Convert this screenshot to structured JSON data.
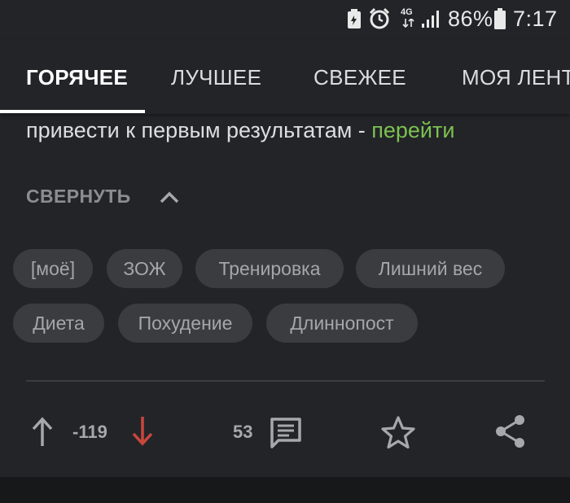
{
  "status_bar": {
    "network": "4G",
    "battery": "86%",
    "time": "7:17",
    "icons": [
      "battery-saver-icon",
      "alarm-icon",
      "network-4g-icon",
      "signal-icon",
      "battery-icon"
    ]
  },
  "tabs": [
    {
      "label": "ГОРЯЧЕЕ",
      "active": true
    },
    {
      "label": "ЛУЧШЕЕ",
      "active": false
    },
    {
      "label": "СВЕЖЕЕ",
      "active": false
    },
    {
      "label": "МОЯ ЛЕНТА",
      "active": false
    }
  ],
  "post": {
    "lead_text": "привести к первым результатам - ",
    "lead_link": "перейти",
    "collapse_label": "СВЕРНУТЬ",
    "tags": [
      "[моё]",
      "ЗОЖ",
      "Тренировка",
      "Лишний вес",
      "Диета",
      "Похудение",
      "Длиннопост"
    ],
    "rating": "-119",
    "comments": "53"
  },
  "colors": {
    "background": "#222428",
    "link": "#7cc150",
    "downvote": "#c9463d",
    "tag_bg": "#3a3c40"
  }
}
